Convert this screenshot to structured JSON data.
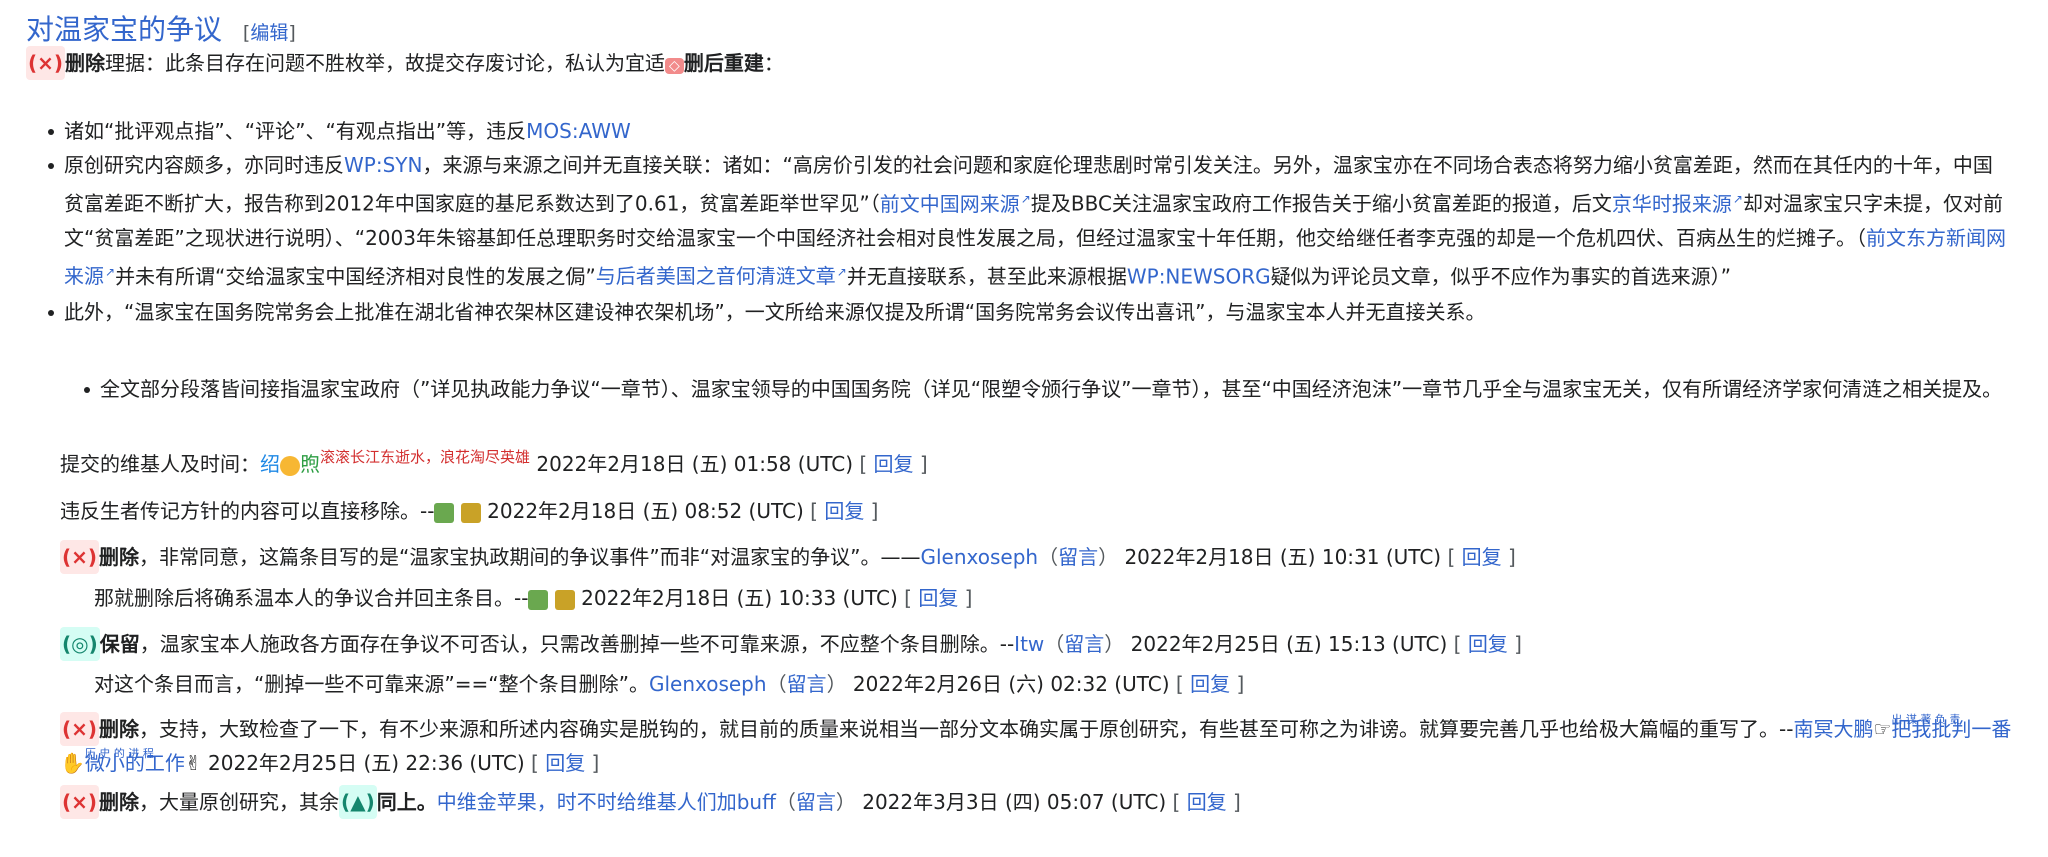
{
  "section": {
    "title": "对温家宝的争议",
    "edit_prefix": "[",
    "edit_label": "编辑",
    "edit_suffix": "]"
  },
  "nomination": {
    "badge": "(×)",
    "vote": "删除",
    "text1": "理据：此条目存在问题不胜枚举，故提交存废讨论，私认为宜适",
    "rebuild_badge": "◇",
    "rebuild_label": "删后重建",
    "colon": "："
  },
  "bullets": {
    "b1_text": "诸如“批评观点指”、“评论”、“有观点指出”等，违反",
    "b1_link": "MOS:AWW",
    "b2_t1": "原创研究内容颇多，亦同时违反",
    "b2_link1": "WP:SYN",
    "b2_t2": "，来源与来源之间并无直接关联：诸如：“高房价引发的社会问题和家庭伦理悲剧时常引发关注。另外，温家宝亦在不同场合表态将努力缩小贫富差距，然而在其任内的十年，中国贫富差距不断扩大，报告称到2012年中国家庭的基尼系数达到了0.61，贫富差距举世罕见”（",
    "b2_link2": "前文中国网来源",
    "b2_t3": "提及BBC关注温家宝政府工作报告关于缩小贫富差距的报道，后文",
    "b2_link3": "京华时报来源",
    "b2_t4": "却对温家宝只字未提，仅对前文“贫富差距”之现状进行说明）、“2003年朱镕基卸任总理职务时交给温家宝一个中国经济社会相对良性发展之局，但经过温家宝十年任期，他交给继任者李克强的却是一个危机四伏、百病丛生的烂摊子。（",
    "b2_link4": "前文东方新闻网来源",
    "b2_t5": "并未有所谓“交给温家宝中国经济相对良性的发展之侷”",
    "b2_link5": "与后者美国之音何清涟文章",
    "b2_t6": "并无直接联系，甚至此来源根据",
    "b2_link6": "WP:NEWSORG",
    "b2_t7": "疑似为评论员文章，似乎不应作为事实的首选来源）”",
    "b3_text": "此外，“温家宝在国务院常务会上批准在湖北省神农架林区建设神农架机场”，一文所给来源仅提及所谓“国务院常务会议传出喜讯”，与温家宝本人并无直接关系。",
    "b4_text": "全文部分段落皆间接指温家宝政府（”详见执政能力争议“一章节）、温家宝领导的中国国务院（详见“限塑令颁行争议”一章节），甚至“中国经济泡沫”一章节几乎全与温家宝无关，仅有所谓经济学家何清涟之相关提及。"
  },
  "submitter": {
    "label": "提交的维基人及时间：",
    "sig_char1": "绍",
    "sig_char2": "煦",
    "sig_motto": "滚滚长江东逝水，浪花淘尽英雄",
    "time": "2022年2月18日 (五) 01:58 (UTC)",
    "reply": "回复"
  },
  "comments": [
    {
      "text": "违反生者传记方针的内容可以直接移除。--",
      "time": "2022年2月18日 (五) 08:52 (UTC)",
      "reply": "回复"
    },
    {
      "badge": "(×)",
      "vote": "删除",
      "text": "，非常同意，这篇条目写的是“温家宝执政期间的争议事件”而非“对温家宝的争议”。——",
      "user": "Glenxoseph",
      "talk": "留言",
      "time": "2022年2月18日 (五) 10:31 (UTC)",
      "reply": "回复"
    },
    {
      "text": "那就删除后将确系温本人的争议合并回主条目。--",
      "time": "2022年2月18日 (五) 10:33 (UTC)",
      "reply": "回复"
    },
    {
      "badge": "(◎)",
      "vote": "保留",
      "text": "，温家宝本人施政各方面存在争议不可否认，只需改善删掉一些不可靠来源，不应整个条目删除。--",
      "user": "Itw",
      "talk": "留言",
      "time": "2022年2月25日 (五) 15:13 (UTC)",
      "reply": "回复"
    },
    {
      "text": "对这个条目而言，“删掉一些不可靠来源”==“整个条目删除”。",
      "user": "Glenxoseph",
      "talk": "留言",
      "time": "2022年2月26日 (六) 02:32 (UTC)",
      "reply": "回复"
    },
    {
      "badge": "(×)",
      "vote": "删除",
      "text": "，支持，大致检查了一下，有不少来源和所述内容确实是脱钩的，就目前的质量来说相当一部分文本确实属于原创研究，有些甚至可称之为诽谤。就算要完善几乎也给极大篇幅的重写了。--",
      "user": "南冥大鹏",
      "sig_a": "把我批判一番",
      "sig_a_ruby": "出 谋 著 负 责",
      "sig_b": "微小的工作",
      "sig_b_ruby": "历 史 的 进 程",
      "time": "2022年2月25日 (五) 22:36 (UTC)",
      "reply": "回复"
    },
    {
      "badge": "(×)",
      "vote": "删除",
      "text": "，大量原创研究，其余",
      "same_badge": "(▲)",
      "same_label": "同上",
      "dot": "。",
      "user": "中维金苹果，时不时给维基人们加buff",
      "talk": "留言",
      "time": "2022年3月3日 (四) 05:07 (UTC)",
      "reply": "回复"
    }
  ]
}
